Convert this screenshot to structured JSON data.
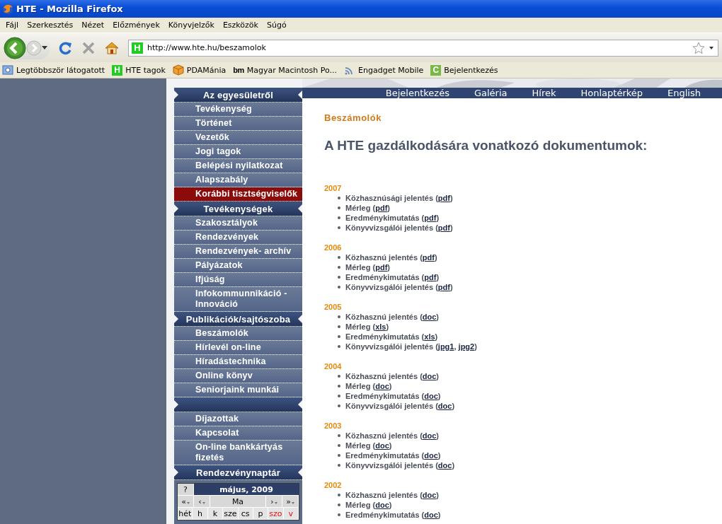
{
  "window": {
    "title": "HTE - Mozilla Firefox"
  },
  "menu_bar": [
    "Fájl",
    "Szerkesztés",
    "Nézet",
    "Előzmények",
    "Könyvjelzők",
    "Eszközök",
    "Súgó"
  ],
  "address_bar": {
    "badge": "H",
    "url": "http://www.hte.hu/beszamolok"
  },
  "bookmarks": [
    {
      "kind": "folder",
      "label": "Legtöbbször látogatott"
    },
    {
      "kind": "badge",
      "badge": "H",
      "color": "#22cc22",
      "label": "HTE tagok"
    },
    {
      "kind": "box",
      "label": "PDAMánia"
    },
    {
      "kind": "text",
      "badge": "bm",
      "label": "Magyar Macintosh Po..."
    },
    {
      "kind": "feed",
      "label": "Engadget Mobile"
    },
    {
      "kind": "badge",
      "badge": "C",
      "color": "#7ab848",
      "label": "Bejelentkezés"
    }
  ],
  "sidebar": {
    "sections": [
      {
        "title": "Az egyesületről",
        "items": [
          {
            "label": "Tevékenység",
            "selected": false
          },
          {
            "label": "Történet",
            "selected": false
          },
          {
            "label": "Vezetők",
            "selected": false
          },
          {
            "label": "Jogi tagok",
            "selected": false
          },
          {
            "label": "Belépési nyilatkozat",
            "selected": false
          },
          {
            "label": "Alapszabály",
            "selected": false
          },
          {
            "label": "Korábbi tisztségviselők",
            "selected": true
          }
        ]
      },
      {
        "title": "Tevékenységek",
        "items": [
          {
            "label": "Szakosztályok",
            "selected": false
          },
          {
            "label": "Rendezvények",
            "selected": false
          },
          {
            "label": "Rendezvények- archív",
            "selected": false
          },
          {
            "label": "Pályázatok",
            "selected": false
          },
          {
            "label": "Ifjúság",
            "selected": false
          },
          {
            "label": "Infokommunnikáció - Innováció",
            "selected": false
          }
        ]
      },
      {
        "title": "Publikációk/sajtószoba",
        "items": [
          {
            "label": "Beszámolók",
            "selected": false
          },
          {
            "label": "Hírlevél on-line",
            "selected": false
          },
          {
            "label": "Híradástechnika",
            "selected": false
          },
          {
            "label": "Online könyv",
            "selected": false
          },
          {
            "label": "Seniorjaink munkái",
            "selected": false
          }
        ]
      },
      {
        "items": [
          {
            "label": "Díjazottak",
            "selected": false
          },
          {
            "label": "Kapcsolat",
            "selected": false
          },
          {
            "label": "On-line bankkártyás fizetés",
            "selected": false
          }
        ]
      },
      {
        "title": "Rendezvénynaptár"
      }
    ],
    "calendar": {
      "help": "?",
      "month": "május, 2009",
      "nav": [
        "«",
        "‹",
        "Ma",
        "›",
        "»"
      ],
      "weekdays": [
        {
          "label": "hét",
          "weekend": false
        },
        {
          "label": "h",
          "weekend": false
        },
        {
          "label": "k",
          "weekend": false
        },
        {
          "label": "sze",
          "weekend": false
        },
        {
          "label": "cs",
          "weekend": false
        },
        {
          "label": "p",
          "weekend": false
        },
        {
          "label": "szo",
          "weekend": true
        },
        {
          "label": "v",
          "weekend": true
        }
      ]
    }
  },
  "top_nav": [
    "Bejelentkezés",
    "Galéria",
    "Hírek",
    "Honlaptérkép",
    "English"
  ],
  "breadcrumb": "Beszámolók",
  "heading": "A HTE gazdálkodására vonatkozó dokumentumok:",
  "reports": [
    {
      "year": "2007",
      "items": [
        [
          {
            "text": "Közhasznúsági jelentés ("
          },
          {
            "link": "pdf"
          },
          {
            "text": ")"
          }
        ],
        [
          {
            "text": "Mérleg ("
          },
          {
            "link": "pdf"
          },
          {
            "text": ")"
          }
        ],
        [
          {
            "text": "Eredménykimutatás ("
          },
          {
            "link": "pdf"
          },
          {
            "text": ")"
          }
        ],
        [
          {
            "text": "Könyvvizsgálói jelentés ("
          },
          {
            "link": "pdf"
          },
          {
            "text": ")"
          }
        ]
      ]
    },
    {
      "year": "2006",
      "items": [
        [
          {
            "text": "Közhasznú jelentés ("
          },
          {
            "link": "pdf"
          },
          {
            "text": ")"
          }
        ],
        [
          {
            "text": "Mérleg ("
          },
          {
            "link": "pdf"
          },
          {
            "text": ")"
          }
        ],
        [
          {
            "text": "Eredménykimutatás ("
          },
          {
            "link": "pdf"
          },
          {
            "text": ")"
          }
        ],
        [
          {
            "text": "Könyvvizsgálói jelentés ("
          },
          {
            "link": "pdf"
          },
          {
            "text": ")"
          }
        ]
      ]
    },
    {
      "year": "2005",
      "items": [
        [
          {
            "text": "Közhasznú jelentés ("
          },
          {
            "link": "doc"
          },
          {
            "text": ")"
          }
        ],
        [
          {
            "text": "Mérleg ("
          },
          {
            "link": "xls"
          },
          {
            "text": ")"
          }
        ],
        [
          {
            "text": "Eredménykimutatás ("
          },
          {
            "link": "xls"
          },
          {
            "text": ")"
          }
        ],
        [
          {
            "text": "Könyvvizsgálói jelentés ("
          },
          {
            "link": "jpg1"
          },
          {
            "text": ", "
          },
          {
            "link": "jpg2"
          },
          {
            "text": ")"
          }
        ]
      ]
    },
    {
      "year": "2004",
      "items": [
        [
          {
            "text": "Közhasznú jelentés ("
          },
          {
            "link": "doc"
          },
          {
            "text": ")"
          }
        ],
        [
          {
            "text": "Mérleg ("
          },
          {
            "link": "doc"
          },
          {
            "text": ")"
          }
        ],
        [
          {
            "text": "Eredménykimutatás ("
          },
          {
            "link": "doc"
          },
          {
            "text": ")"
          }
        ],
        [
          {
            "text": "Könyvvizsgálói jelentés ("
          },
          {
            "link": "doc"
          },
          {
            "text": ")"
          }
        ]
      ]
    },
    {
      "year": "2003",
      "items": [
        [
          {
            "text": "Közhasznú jelentés ("
          },
          {
            "link": "doc"
          },
          {
            "text": ")"
          }
        ],
        [
          {
            "text": "Mérleg ("
          },
          {
            "link": "doc"
          },
          {
            "text": ")"
          }
        ],
        [
          {
            "text": "Eredménykimutatás ("
          },
          {
            "link": "doc"
          },
          {
            "text": ")"
          }
        ],
        [
          {
            "text": "Könyvvizsgálói jelentés ("
          },
          {
            "link": "doc"
          },
          {
            "text": ")"
          }
        ]
      ]
    },
    {
      "year": "2002",
      "items": [
        [
          {
            "text": "Közhasznú jelentés ("
          },
          {
            "link": "doc"
          },
          {
            "text": ")"
          }
        ],
        [
          {
            "text": "Mérleg ("
          },
          {
            "link": "doc"
          },
          {
            "text": ")"
          }
        ],
        [
          {
            "text": "Eredménykimutatás ("
          },
          {
            "link": "doc"
          },
          {
            "text": ")"
          }
        ]
      ]
    }
  ]
}
